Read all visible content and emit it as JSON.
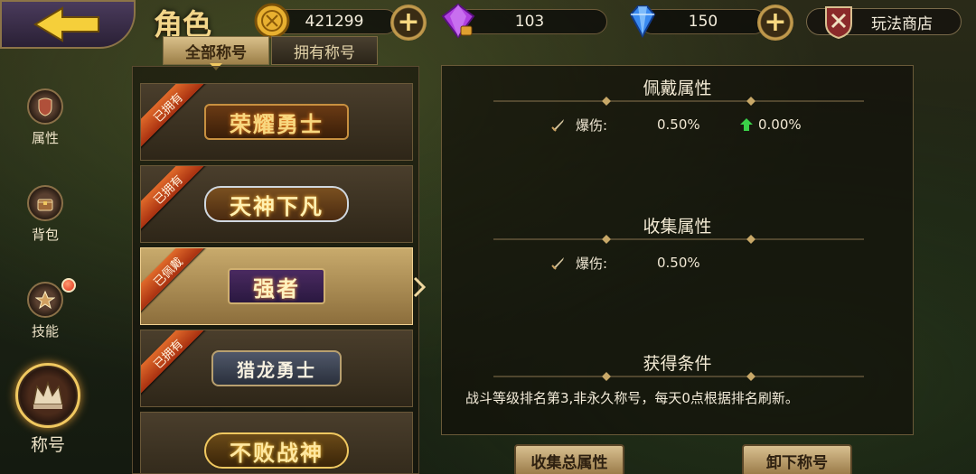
{
  "header": {
    "title": "角色",
    "gold": "421299",
    "purple_gem": "103",
    "diamond": "150",
    "shop_label": "玩法商店"
  },
  "tabs": [
    {
      "label": "全部称号",
      "active": true
    },
    {
      "label": "拥有称号",
      "active": false
    }
  ],
  "sidebar": [
    {
      "label": "属性",
      "icon": "armor-icon"
    },
    {
      "label": "背包",
      "icon": "chest-icon"
    },
    {
      "label": "技能",
      "icon": "skill-icon",
      "badge": true
    },
    {
      "label": "称号",
      "icon": "crown-icon",
      "active": true
    }
  ],
  "titles": [
    {
      "name": "荣耀勇士",
      "ribbon": "已拥有"
    },
    {
      "name": "天神下凡",
      "ribbon": "已拥有"
    },
    {
      "name": "强者",
      "ribbon": "已佩戴",
      "selected": true
    },
    {
      "name": "猎龙勇士",
      "ribbon": "已拥有"
    },
    {
      "name": "不败战神",
      "ribbon": ""
    }
  ],
  "detail": {
    "equip_title": "佩戴属性",
    "equip_stat_name": "爆伤:",
    "equip_stat_value": "0.50%",
    "equip_stat_delta": "0.00%",
    "collect_title": "收集属性",
    "collect_stat_name": "爆伤:",
    "collect_stat_value": "0.50%",
    "cond_title": "获得条件",
    "cond_text": "战斗等级排名第3,非永久称号，每天0点根据排名刷新。"
  },
  "buttons": {
    "collect_total": "收集总属性",
    "unequip": "卸下称号"
  },
  "colors": {
    "accent_gold": "#f0c860",
    "ribbon_orange": "#e06a2a",
    "up_green": "#3ad048"
  }
}
